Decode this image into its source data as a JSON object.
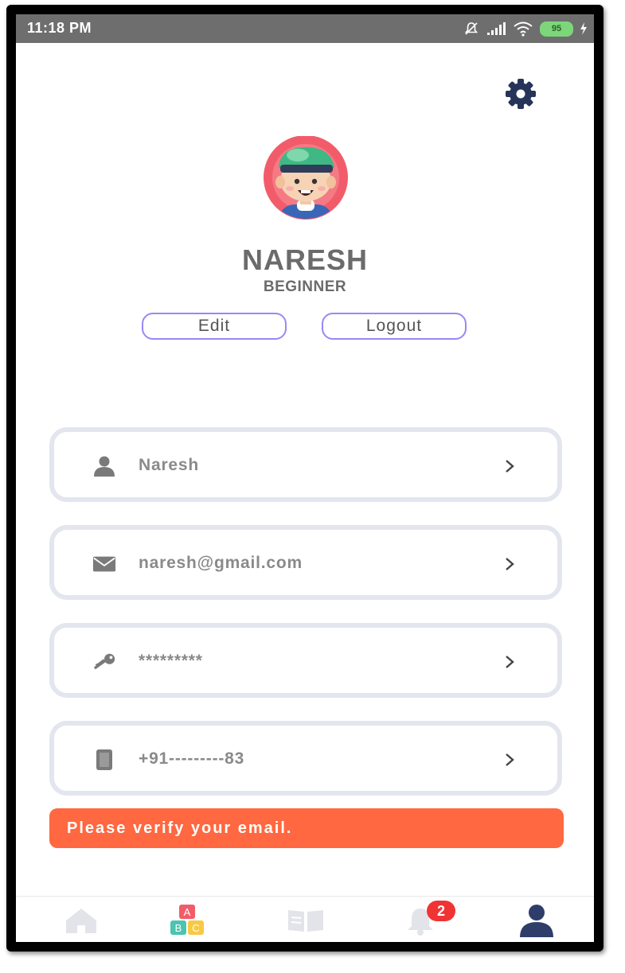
{
  "status_bar": {
    "time": "11:18 PM",
    "battery": "95",
    "icons": [
      "mute-icon",
      "signal-icon",
      "wifi-icon",
      "battery-icon",
      "charging-icon"
    ]
  },
  "profile": {
    "name": "NARESH",
    "level": "BEGINNER",
    "edit_label": "Edit",
    "logout_label": "Logout"
  },
  "fields": [
    {
      "icon": "person-icon",
      "value": "Naresh"
    },
    {
      "icon": "mail-icon",
      "value": "naresh@gmail.com"
    },
    {
      "icon": "key-icon",
      "value": "*********"
    },
    {
      "icon": "phone-icon",
      "value": "+91---------83"
    }
  ],
  "banner": {
    "text": "Please verify your email.",
    "color": "#ff6840"
  },
  "bottom_nav": {
    "items": [
      "home-icon",
      "abc-blocks-icon",
      "book-icon",
      "bell-icon",
      "profile-icon"
    ],
    "notification_count": "2",
    "active": "profile-icon"
  },
  "colors": {
    "accent": "#9b87f5",
    "nav_active": "#2f3d6b",
    "card_border": "#e3e6ee"
  }
}
